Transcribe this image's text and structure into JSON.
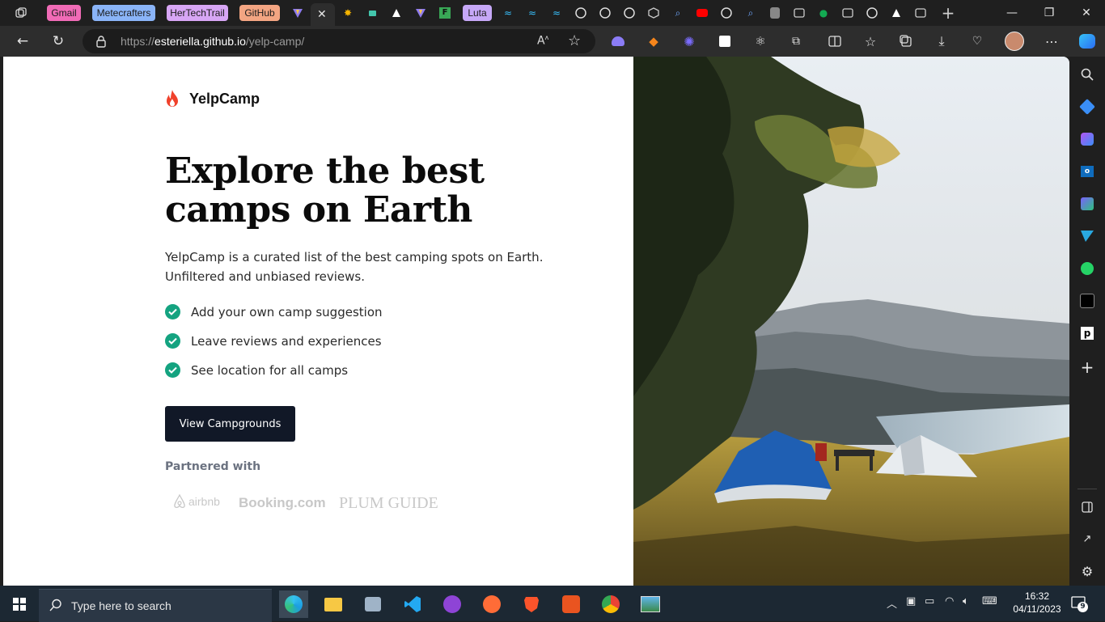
{
  "browser": {
    "tab_groups": [
      {
        "label": "Gmail",
        "color": "#f06bb6"
      },
      {
        "label": "Metecrafters",
        "color": "#8ab4f8"
      },
      {
        "label": "HerTechTrail",
        "color": "#d7a6f5"
      },
      {
        "label": "GitHub",
        "color": "#f3a582"
      },
      {
        "label": "Luta",
        "color": "#c6a8f7"
      }
    ],
    "url_prefix": "https://",
    "url_host": "esteriella.github.io",
    "url_path": "/yelp-camp/"
  },
  "page": {
    "logo_text": "YelpCamp",
    "headline": "Explore the best camps on Earth",
    "intro": "YelpCamp is a curated list of the best camping spots on Earth. Unfiltered and unbiased reviews.",
    "features": [
      "Add your own camp suggestion",
      "Leave reviews and experiences",
      "See location for all camps"
    ],
    "cta_label": "View Campgrounds",
    "partnered_label": "Partnered with",
    "partners": [
      "airbnb",
      "Booking.com",
      "PLUM GUIDE"
    ],
    "accent_color": "#14a380",
    "button_color": "#111827"
  },
  "taskbar": {
    "search_placeholder": "Type here to search",
    "time": "16:32",
    "date": "04/11/2023",
    "notification_count": "9"
  }
}
